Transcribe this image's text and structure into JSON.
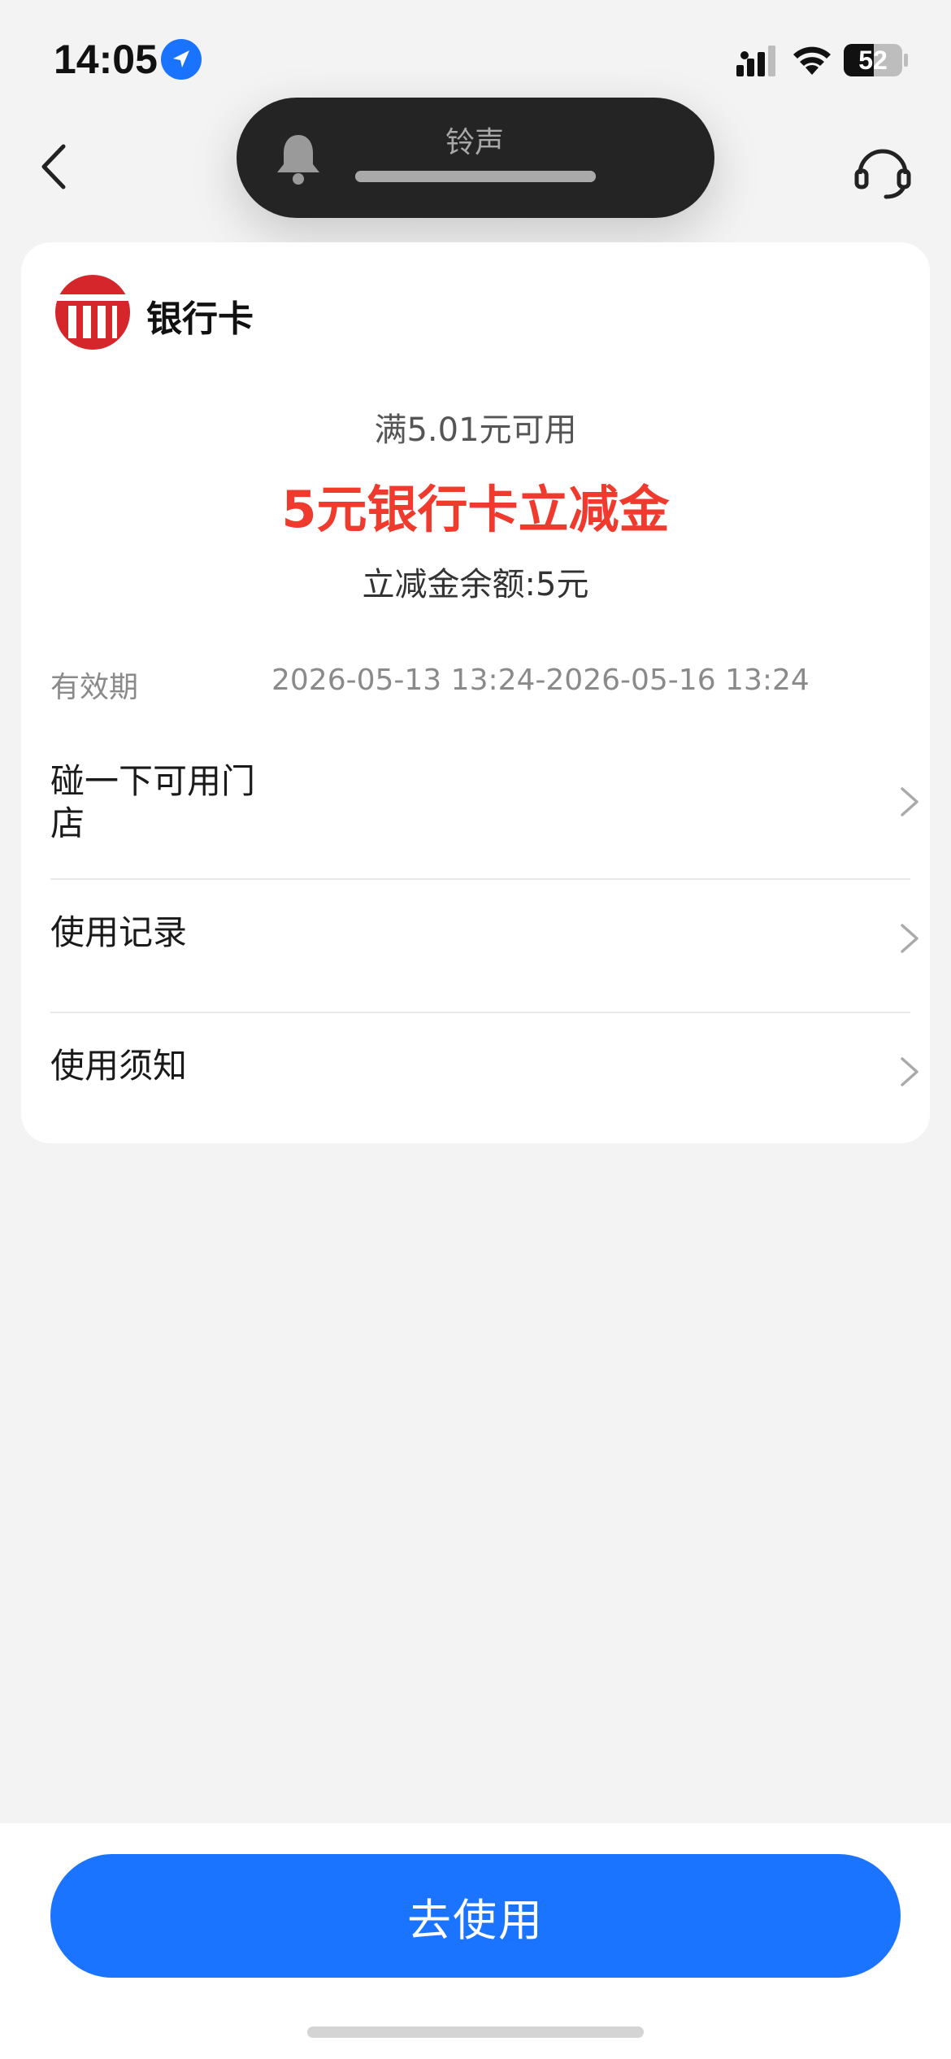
{
  "status_bar": {
    "time": "14:05",
    "battery_level": "52",
    "battery_fraction": 0.52,
    "icons": [
      "location-arrow-icon",
      "cellular-signal-icon",
      "wifi-icon",
      "battery-icon"
    ]
  },
  "nav": {
    "back_icon": "chevron-left-icon",
    "support_icon": "headset-icon"
  },
  "ringer": {
    "label": "铃声",
    "icon": "bell-icon",
    "volume_fraction": 1.0
  },
  "card": {
    "bank_icon": "bank-building-icon",
    "bank_name": "银行卡",
    "min_spend": "满5.01元可用",
    "coupon_title": "5元银行卡立减金",
    "balance_label": "立减金余额:",
    "balance_value": "5元",
    "validity_label": "有效期",
    "validity_value": "2026-05-13 13:24-2026-05-16 13:24",
    "rows": [
      {
        "label_line1": "碰一下可用门",
        "label_line2": "店"
      },
      {
        "label": "使用记录"
      },
      {
        "label": "使用须知"
      }
    ],
    "colors": {
      "accent_red": "#f03a2e",
      "brand_red": "#d4262b"
    }
  },
  "bottom": {
    "use_button_label": "去使用",
    "button_color": "#1a74ff"
  }
}
